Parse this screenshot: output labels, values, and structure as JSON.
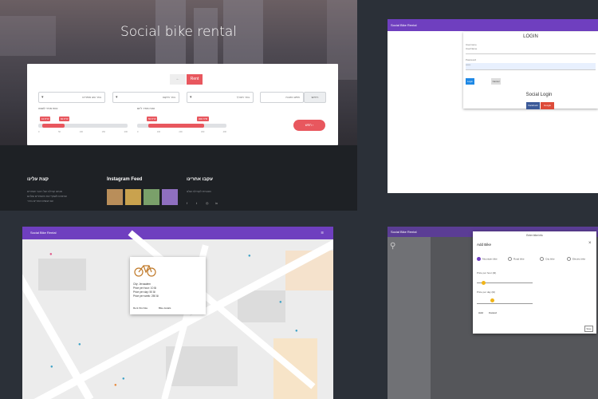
{
  "rental_page": {
    "title": "Social bike rental",
    "toggle": {
      "left": "←",
      "right": "Rent"
    },
    "filters": [
      {
        "placeholder": "בחר סוג אופניים"
      },
      {
        "placeholder": "בחר מיקום"
      },
      {
        "placeholder": "בחר תאריך"
      }
    ],
    "search": {
      "placeholder": "חפש כתובת",
      "button": "חיפוש"
    },
    "sliders": [
      {
        "label": "טווח מחיר לשעה",
        "tags": [
          "10 ש\"ח",
          "60 ש\"ח"
        ],
        "ticks": [
          "0",
          "50",
          "100",
          "150",
          "200"
        ],
        "low": 0.1,
        "high": 0.35
      },
      {
        "label": "טווח מחיר ליום",
        "tags": [
          "50 ש\"ח",
          "300 ש\"ח"
        ],
        "ticks": [
          "0",
          "100",
          "200",
          "300",
          "400"
        ],
        "low": 0.1,
        "high": 0.7
      }
    ],
    "submit": "חפש ›",
    "footer": {
      "about": {
        "heading": "קצת עלינו",
        "text": [
          "אנחנו קהילה של רוכבי אופניים",
          "שרוצים לשתף את האופניים שלהם",
          "עם אנשים אחרים בעיר"
        ]
      },
      "instagram": {
        "heading": "Instagram Feed"
      },
      "social": {
        "heading": "עקבו אחרינו",
        "text": "הצטרפו לקהילה שלנו",
        "icons": [
          "f",
          "t",
          "◎",
          "in"
        ]
      }
    }
  },
  "login_page": {
    "appbar": "Social Bike Rental",
    "card_title": "LOGIN",
    "username_label": "Username",
    "username_value": "UserName",
    "password_label": "Password",
    "password_value": "••••••",
    "login_button": "Login",
    "cancel_button": "Cancel",
    "social_title": "Social Login",
    "facebook": "Facebook",
    "google": "Google"
  },
  "map_page": {
    "appbar": "Social Bike Rental",
    "popup": {
      "lines": [
        "City: Jerusalem",
        "Price per hour: 10 ₪",
        "Price per day: 50 ₪",
        "Price per week: 250 ₪"
      ],
      "rent": "Rent this bike",
      "details": "Bike details"
    }
  },
  "add_bike_page": {
    "appbar": "Social Bike Rental",
    "dialog_title": "Enter bike info",
    "address": "Add Bike",
    "close": "×",
    "types": [
      "Mountain bike",
      "Road bike",
      "City bike",
      "Electric bike"
    ],
    "price_hour": "Price per hour (₪)",
    "price_day": "Price per day (₪)",
    "add": "Add",
    "cancel": "Cancel",
    "save": "Save"
  },
  "colors": {
    "accent": "#e8575e",
    "appbar": "#6f3fbf",
    "facebook": "#3b5998",
    "google": "#dd4b39"
  }
}
